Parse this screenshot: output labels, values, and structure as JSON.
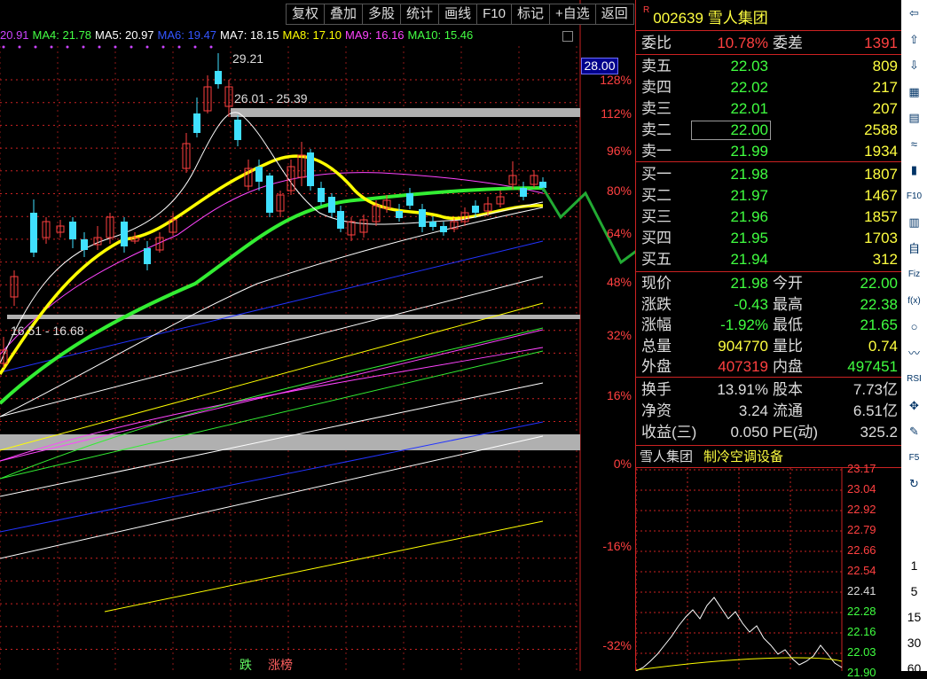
{
  "toolbar": {
    "items": [
      "复权",
      "叠加",
      "多股",
      "统计",
      "画线",
      "F10",
      "标记",
      "+自选",
      "返回"
    ]
  },
  "ma_legend": [
    {
      "label": "20.91",
      "color": "#cc44ff"
    },
    {
      "label": "MA4: 21.78",
      "color": "#44ff44"
    },
    {
      "label": "MA5: 20.97",
      "color": "#ffffff"
    },
    {
      "label": "MA6: 19.47",
      "color": "#3355ff"
    },
    {
      "label": "MA7: 18.15",
      "color": "#ffffff"
    },
    {
      "label": "MA8: 17.10",
      "color": "#ffff00"
    },
    {
      "label": "MA9: 16.16",
      "color": "#ff44ff"
    },
    {
      "label": "MA10: 15.46",
      "color": "#44ff44"
    }
  ],
  "chart": {
    "price_tag": "28.00",
    "pct_axis": [
      "128%",
      "112%",
      "96%",
      "80%",
      "64%",
      "48%",
      "32%",
      "16%",
      "0%",
      "-16%",
      "-32%"
    ],
    "annotations": {
      "high": "29.21",
      "band_top": "26.01 - 25.39",
      "band_mid": "16.51 - 16.68"
    },
    "bottom_tabs": {
      "down": "跌",
      "limit": "涨榜"
    },
    "colors": {
      "up": "#ff4040",
      "down": "#40e0ff",
      "ma_yellow": "#ffff00",
      "ma_green": "#33ee33",
      "band": "#b0b0b0"
    }
  },
  "quote": {
    "code": "002639",
    "name": "雪人集团",
    "badge": "R",
    "weibi": {
      "label": "委比",
      "value": "10.78%",
      "label2": "委差",
      "value2": "1391"
    },
    "asks": [
      {
        "label": "卖五",
        "price": "22.03",
        "vol": "809"
      },
      {
        "label": "卖四",
        "price": "22.02",
        "vol": "217"
      },
      {
        "label": "卖三",
        "price": "22.01",
        "vol": "207"
      },
      {
        "label": "卖二",
        "price": "22.00",
        "vol": "2588"
      },
      {
        "label": "卖一",
        "price": "21.99",
        "vol": "1934"
      }
    ],
    "bids": [
      {
        "label": "买一",
        "price": "21.98",
        "vol": "1807"
      },
      {
        "label": "买二",
        "price": "21.97",
        "vol": "1467"
      },
      {
        "label": "买三",
        "price": "21.96",
        "vol": "1857"
      },
      {
        "label": "买四",
        "price": "21.95",
        "vol": "1703"
      },
      {
        "label": "买五",
        "price": "21.94",
        "vol": "312"
      }
    ],
    "stats": [
      {
        "l": "现价",
        "v": "21.98",
        "vc": "green",
        "l2": "今开",
        "v2": "22.00",
        "v2c": "green"
      },
      {
        "l": "涨跌",
        "v": "-0.43",
        "vc": "green",
        "l2": "最高",
        "v2": "22.38",
        "v2c": "green"
      },
      {
        "l": "涨幅",
        "v": "-1.92%",
        "vc": "green",
        "l2": "最低",
        "v2": "21.65",
        "v2c": "green"
      },
      {
        "l": "总量",
        "v": "904770",
        "vc": "yellow",
        "l2": "量比",
        "v2": "0.74",
        "v2c": "yellow"
      },
      {
        "l": "外盘",
        "v": "407319",
        "vc": "red",
        "l2": "内盘",
        "v2": "497451",
        "v2c": "green"
      }
    ],
    "stats2": [
      {
        "l": "换手",
        "v": "13.91%",
        "l2": "股本",
        "v2": "7.73亿"
      },
      {
        "l": "净资",
        "v": "3.24",
        "l2": "流通",
        "v2": "6.51亿"
      },
      {
        "l": "收益(三)",
        "v": "0.050",
        "l2": "PE(动)",
        "v2": "325.2"
      }
    ],
    "industry": {
      "name": "雪人集团",
      "sector": "制冷空调设备"
    },
    "mini_axis": [
      "23.17",
      "23.04",
      "22.92",
      "22.79",
      "22.66",
      "22.54",
      "22.41",
      "22.28",
      "22.16",
      "22.03",
      "21.90"
    ]
  },
  "sidebar": {
    "icons": [
      "arrow-left-icon",
      "arrow-up-icon",
      "arrow-down-icon",
      "kline-icon",
      "table-icon",
      "line-chart-icon",
      "candle-icon",
      "f10-icon",
      "report-icon",
      "selfselect-icon",
      "fiz-icon",
      "formula-icon",
      "circle-icon",
      "trend-icon",
      "rsi-icon",
      "move-icon",
      "pen-icon",
      "f5-icon",
      "refresh-icon"
    ],
    "icon_text": [
      "⇦",
      "⇧",
      "⇩",
      "▦",
      "▤",
      "≈",
      "▮",
      "F10",
      "▥",
      "自",
      "Fiz",
      "f(x)",
      "○",
      "〰",
      "RSI",
      "✥",
      "✎",
      "F5",
      "↻"
    ],
    "numbers": [
      "1",
      "5",
      "15",
      "30",
      "60"
    ]
  }
}
